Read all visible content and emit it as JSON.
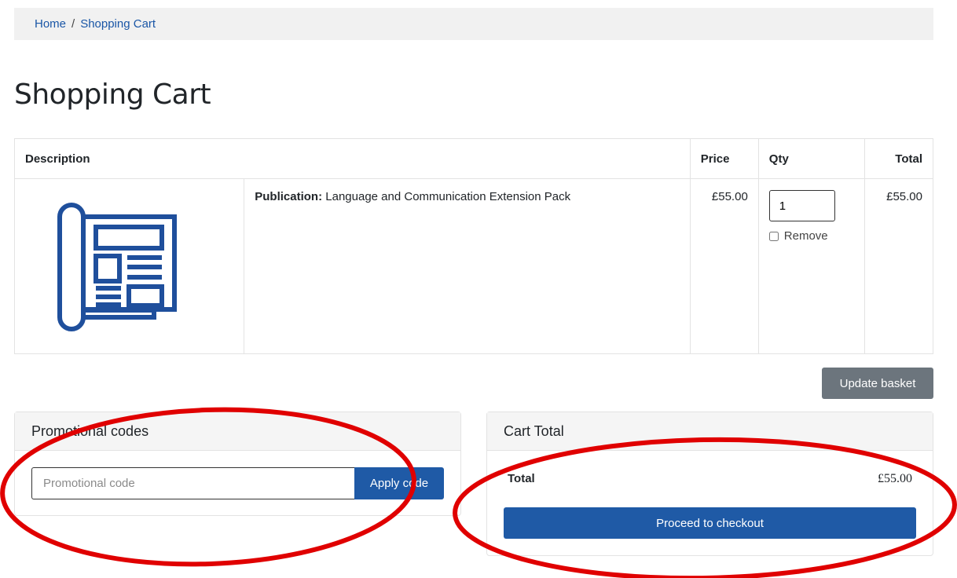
{
  "breadcrumb": {
    "home": "Home",
    "separator": "/",
    "current": "Shopping Cart"
  },
  "page_title": "Shopping Cart",
  "table": {
    "headers": {
      "description": "Description",
      "price": "Price",
      "qty": "Qty",
      "total": "Total"
    },
    "rows": [
      {
        "label": "Publication:",
        "name": "Language and Communication Extension Pack",
        "price": "£55.00",
        "qty": "1",
        "remove_label": "Remove",
        "total": "£55.00",
        "icon": "publication-icon"
      }
    ]
  },
  "update_button": "Update basket",
  "promo": {
    "title": "Promotional codes",
    "placeholder": "Promotional code",
    "apply_label": "Apply code"
  },
  "cart_total": {
    "title": "Cart Total",
    "total_label": "Total",
    "total_value": "£55.00",
    "checkout_label": "Proceed to checkout"
  },
  "colors": {
    "primary": "#1f5aa6",
    "secondary": "#6c757d",
    "icon_blue": "#1f4f9c",
    "annotation_red": "#e00000"
  }
}
